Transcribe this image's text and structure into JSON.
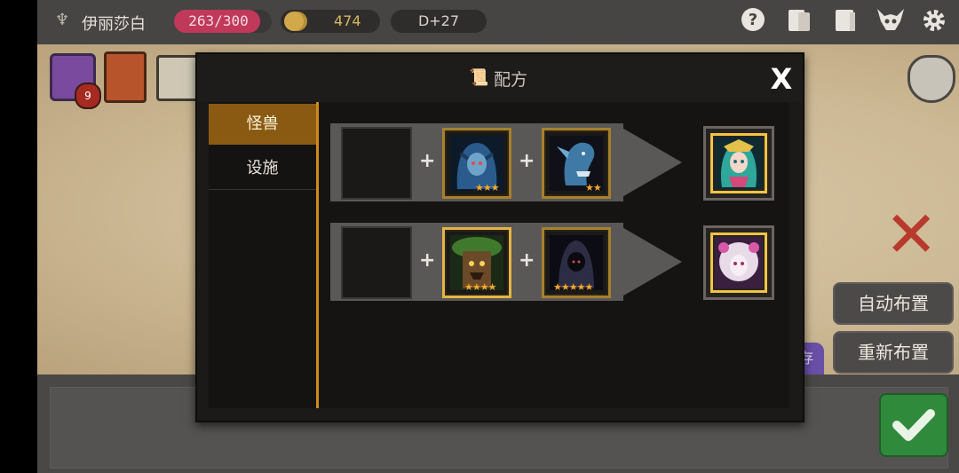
{
  "topbar": {
    "player_name": "伊丽莎白",
    "hp": "263/300",
    "hp_fraction": 0.877,
    "gold": "474",
    "day": "D+27",
    "icons": [
      "help-icon",
      "cards-icon",
      "book-icon",
      "demon-helmet-icon",
      "gear-icon"
    ]
  },
  "map": {
    "chest_badge": "9",
    "purple_tab": "存"
  },
  "buttons": {
    "auto_place": "自动布置",
    "replace": "重新布置"
  },
  "modal": {
    "title": "配方",
    "close_label": "X",
    "tabs": [
      {
        "label": "怪兽",
        "selected": true
      },
      {
        "label": "设施",
        "selected": false
      }
    ],
    "recipes": [
      {
        "ingredient_1": {
          "stars": "★★★"
        },
        "ingredient_2": {
          "stars": "★★"
        },
        "result": {
          "stars": ""
        }
      },
      {
        "ingredient_1": {
          "stars": "★★★★"
        },
        "ingredient_2": {
          "stars": "★★★★★"
        },
        "result": {
          "stars": ""
        }
      }
    ],
    "plus_symbol": "+"
  },
  "colors": {
    "accent_orange": "#d08a18",
    "hp_pink": "#c0395a",
    "gold": "#d8b660",
    "confirm_green": "#2f8a3c"
  }
}
